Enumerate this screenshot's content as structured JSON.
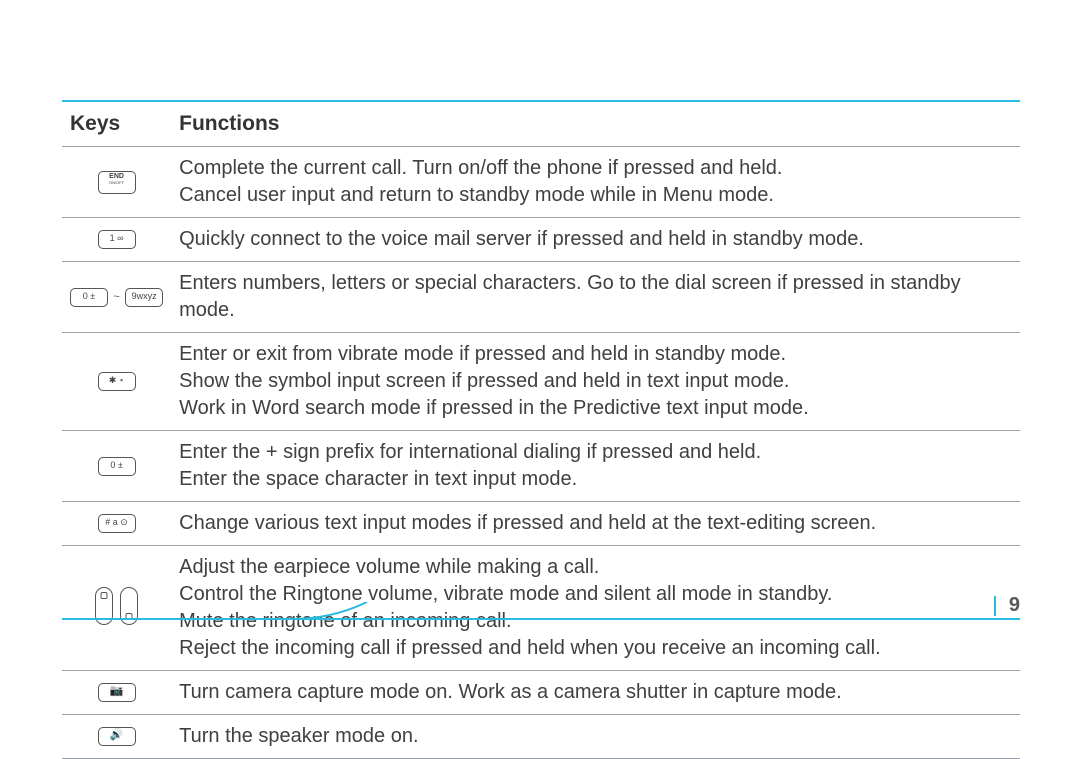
{
  "headers": {
    "keys": "Keys",
    "functions": "Functions"
  },
  "rows": {
    "r0": {
      "key_label1": "END",
      "key_label2": "ON/OFF",
      "fn": "Complete the current call. Turn on/off the phone if pressed and held.\nCancel user input and return to standby mode while in Menu mode."
    },
    "r1": {
      "key_label": "1 ∞",
      "fn": "Quickly connect to the voice mail server if pressed and held in standby mode."
    },
    "r2": {
      "key_label_a": "0 ±",
      "sep": "~",
      "key_label_b": "9wxyz",
      "fn": "Enters numbers, letters or special characters. Go to the dial screen if pressed in standby mode."
    },
    "r3": {
      "key_label": "✱ ⋆",
      "fn": "Enter or exit from vibrate mode if pressed and held in standby mode.\nShow the symbol input screen if pressed and held in text input mode.\nWork in Word search mode if pressed in the Predictive text input mode."
    },
    "r4": {
      "key_label": "0 ±",
      "fn": "Enter the + sign prefix for international dialing if pressed and held.\nEnter the space character in text input mode."
    },
    "r5": {
      "key_label": "# a ⊙",
      "fn": "Change various text input modes if pressed and held at the text-editing screen."
    },
    "r6": {
      "fn": "Adjust the earpiece volume while making a call.\nControl the Ringtone volume, vibrate mode and silent all mode in standby.\nMute the ringtone of an incoming call.\nReject the incoming call if pressed and held when you receive an incoming call."
    },
    "r7": {
      "fn": "Turn camera capture mode on. Work as a camera shutter in capture mode."
    },
    "r8": {
      "fn": "Turn the speaker mode on."
    }
  },
  "page_number": "9"
}
